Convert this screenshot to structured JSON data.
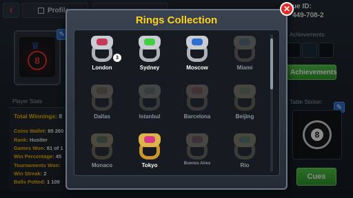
{
  "profile": {
    "tab_profile": "Profile",
    "tab_second": "",
    "unique_id_label": "ue ID:",
    "unique_id_value": "449-708-2",
    "avatar_ball": "8",
    "stats_title": "Player Stats",
    "stats": {
      "total_winnings_label": "Total Winnings:",
      "total_winnings_value": "8",
      "lines": [
        {
          "k": "Coins Wallet:",
          "v": "85 260"
        },
        {
          "k": "Rank:",
          "v": "Hustler"
        },
        {
          "k": "Games Won:",
          "v": "81 of 1"
        },
        {
          "k": "Win Percentage:",
          "v": "45"
        },
        {
          "k": "Tournaments Won:",
          "v": ""
        },
        {
          "k": "Win Streak:",
          "v": "2"
        },
        {
          "k": "Balls Potted:",
          "v": "1 109"
        }
      ]
    },
    "achievements_label": "Achievements:",
    "achievements_button": "Achievements",
    "table_sticker_label": "Table Sticker:",
    "sticker_ball": "8",
    "cues_button": "Cues",
    "edit_glyph": "✎"
  },
  "modal": {
    "title": "Rings Collection",
    "close_glyph": "✕",
    "rings": [
      {
        "name": "London",
        "unlocked": true,
        "count": "3",
        "head": "#c9ccd2",
        "band": "#aeb3bb",
        "gem": "#c23a58"
      },
      {
        "name": "Sydney",
        "unlocked": true,
        "count": "",
        "head": "#c9ccd2",
        "band": "#aeb3bb",
        "gem": "#3fcf3f"
      },
      {
        "name": "Moscow",
        "unlocked": true,
        "count": "",
        "head": "#c9ccd2",
        "band": "#aeb3bb",
        "gem": "#2f6fd0"
      },
      {
        "name": "Miami",
        "unlocked": false,
        "count": "",
        "head": "#8a7a60",
        "band": "#6c604e",
        "gem": "#4a6a8a"
      },
      {
        "name": "Dallas",
        "unlocked": false,
        "count": "",
        "head": "#8a7a60",
        "band": "#6c604e",
        "gem": "#7a5a4a"
      },
      {
        "name": "Istanbul",
        "unlocked": false,
        "count": "",
        "head": "#7a7a6a",
        "band": "#5e5e52",
        "gem": "#5a6a5a"
      },
      {
        "name": "Barcelona",
        "unlocked": false,
        "count": "",
        "head": "#8a7060",
        "band": "#6c5a4e",
        "gem": "#8a4a4a"
      },
      {
        "name": "Beijing",
        "unlocked": false,
        "count": "",
        "head": "#8a7a50",
        "band": "#6c5e40",
        "gem": "#5a7a4a"
      },
      {
        "name": "Monaco",
        "unlocked": false,
        "count": "",
        "head": "#9a8050",
        "band": "#76623e",
        "gem": "#4a6a4a"
      },
      {
        "name": "Tokyo",
        "unlocked": true,
        "count": "",
        "head": "#e0b24a",
        "band": "#c9962e",
        "gem": "#d63a86"
      },
      {
        "name": "Buenos Aires",
        "unlocked": false,
        "count": "",
        "head": "#8a7a60",
        "band": "#6c604e",
        "gem": "#7a4a5a"
      },
      {
        "name": "Rio",
        "unlocked": false,
        "count": "",
        "head": "#8a8050",
        "band": "#6c6440",
        "gem": "#4a7a6a"
      }
    ]
  }
}
